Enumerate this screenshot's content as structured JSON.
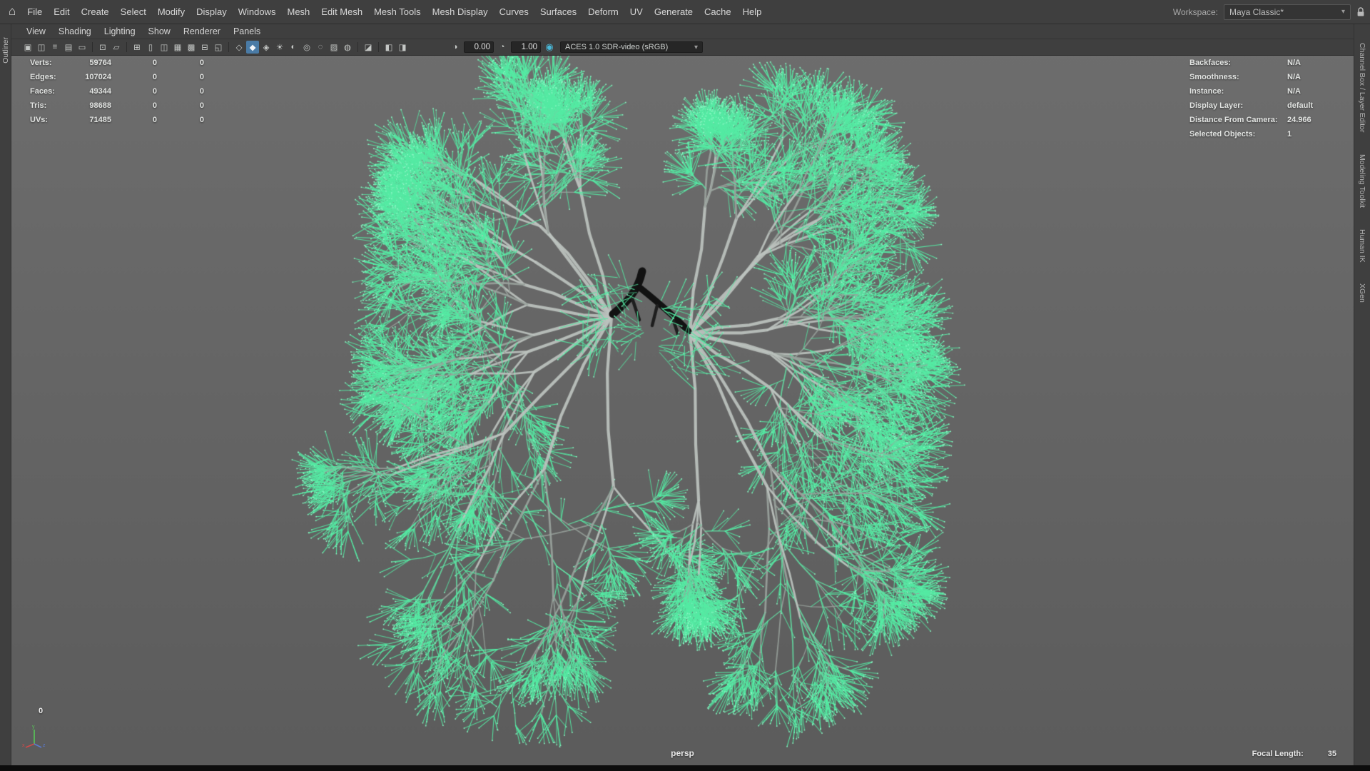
{
  "app": {
    "home_icon": "⌂"
  },
  "menubar": {
    "items": [
      "File",
      "Edit",
      "Create",
      "Select",
      "Modify",
      "Display",
      "Windows",
      "Mesh",
      "Edit Mesh",
      "Mesh Tools",
      "Mesh Display",
      "Curves",
      "Surfaces",
      "Deform",
      "UV",
      "Generate",
      "Cache",
      "Help"
    ]
  },
  "workspace": {
    "label": "Workspace:",
    "value": "Maya Classic*",
    "caret": "▾"
  },
  "panel_menubar": {
    "items": [
      "View",
      "Shading",
      "Lighting",
      "Show",
      "Renderer",
      "Panels"
    ]
  },
  "toolbar": {
    "g1": [
      {
        "name": "select-camera-icon",
        "glyph": "▣"
      },
      {
        "name": "lock-camera-icon",
        "glyph": "◫"
      },
      {
        "name": "camera-attributes-icon",
        "glyph": "≡"
      },
      {
        "name": "bookmarks-icon",
        "glyph": "▤"
      },
      {
        "name": "image-plane-icon",
        "glyph": "▭"
      }
    ],
    "g2": [
      {
        "name": "two-d-pan-zoom-icon",
        "glyph": "⊡"
      },
      {
        "name": "grease-pencil-icon",
        "glyph": "▱"
      }
    ],
    "g3": [
      {
        "name": "grid-icon",
        "glyph": "⊞"
      },
      {
        "name": "film-gate-icon",
        "glyph": "▯"
      },
      {
        "name": "resolution-gate-icon",
        "glyph": "◫"
      },
      {
        "name": "gate-mask-icon",
        "glyph": "▦"
      },
      {
        "name": "field-chart-icon",
        "glyph": "▩"
      },
      {
        "name": "safe-action-icon",
        "glyph": "⊟"
      },
      {
        "name": "safe-title-icon",
        "glyph": "◱"
      }
    ],
    "g4": [
      {
        "name": "wireframe-icon",
        "glyph": "◇"
      },
      {
        "name": "smooth-shade-icon",
        "glyph": "◆",
        "active": true
      },
      {
        "name": "textured-icon",
        "glyph": "◈"
      },
      {
        "name": "use-all-lights-icon",
        "glyph": "☀"
      },
      {
        "name": "shadows-icon",
        "glyph": "◐"
      },
      {
        "name": "screen-space-ao-icon",
        "glyph": "◎"
      },
      {
        "name": "motion-blur-icon",
        "glyph": "◌"
      },
      {
        "name": "anti-aliasing-icon",
        "glyph": "▨"
      },
      {
        "name": "depth-of-field-icon",
        "glyph": "◍"
      }
    ],
    "g5": [
      {
        "name": "isolate-select-icon",
        "glyph": "◪"
      }
    ],
    "g6": [
      {
        "name": "x-ray-icon",
        "glyph": "◧"
      },
      {
        "name": "x-ray-joints-icon",
        "glyph": "◨"
      }
    ],
    "exposure_icon": "◑",
    "exposure": "0.00",
    "gamma_icon": "◔",
    "gamma": "1.00",
    "color_management_icon": "◉",
    "view_transform": "ACES 1.0 SDR-video (sRGB)",
    "caret": "▾"
  },
  "hud": {
    "left_rows": [
      {
        "label": "Verts:",
        "value": "59764",
        "c2": "0",
        "c3": "0"
      },
      {
        "label": "Edges:",
        "value": "107024",
        "c2": "0",
        "c3": "0"
      },
      {
        "label": "Faces:",
        "value": "49344",
        "c2": "0",
        "c3": "0"
      },
      {
        "label": "Tris:",
        "value": "98688",
        "c2": "0",
        "c3": "0"
      },
      {
        "label": "UVs:",
        "value": "71485",
        "c2": "0",
        "c3": "0"
      }
    ],
    "right_rows": [
      {
        "label": "Backfaces:",
        "value": "N/A"
      },
      {
        "label": "Smoothness:",
        "value": "N/A"
      },
      {
        "label": "Instance:",
        "value": "N/A"
      },
      {
        "label": "Display Layer:",
        "value": "default"
      },
      {
        "label": "Distance From Camera:",
        "value": "24.966"
      },
      {
        "label": "Selected Objects:",
        "value": "1"
      }
    ],
    "frame": "0",
    "camera": "persp",
    "focal_length_label": "Focal Length:",
    "focal_length_value": "35"
  },
  "sidebars": {
    "left_tab": "Outliner",
    "right_tabs": [
      "Channel Box / Layer Editor",
      "Modeling Toolkit",
      "Human IK",
      "XGen"
    ]
  },
  "colors": {
    "needle_green": "#55eba4",
    "needle_bright": "#93f8c9",
    "branch_gray": "#bcc2be",
    "branch_gray2": "#99a29c",
    "branch_green": "#63dfa3",
    "trachea_dark": "#121212",
    "vp_top": "#6d6d6d",
    "vp_bottom": "#5c5c5c"
  }
}
